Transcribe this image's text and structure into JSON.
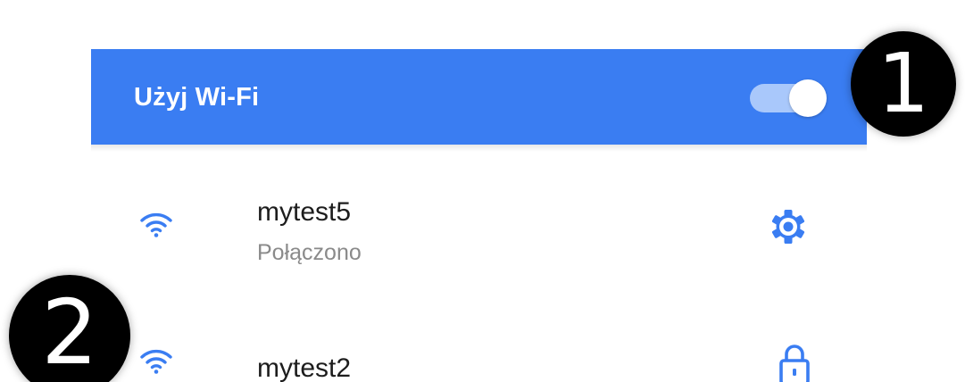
{
  "wifi_header": {
    "title": "Użyj Wi-Fi",
    "toggle_state": "on",
    "bar_color": "#3a7df2",
    "accent_color": "#3a7df2"
  },
  "markers": [
    "1",
    "2"
  ],
  "networks": [
    {
      "ssid": "mytest5",
      "status": "Połączono",
      "signal_icon": "wifi-full-icon",
      "action_icon": "gear-icon"
    },
    {
      "ssid": "mytest2",
      "signal_icon": "wifi-full-icon",
      "action_icon": "lock-icon"
    }
  ]
}
